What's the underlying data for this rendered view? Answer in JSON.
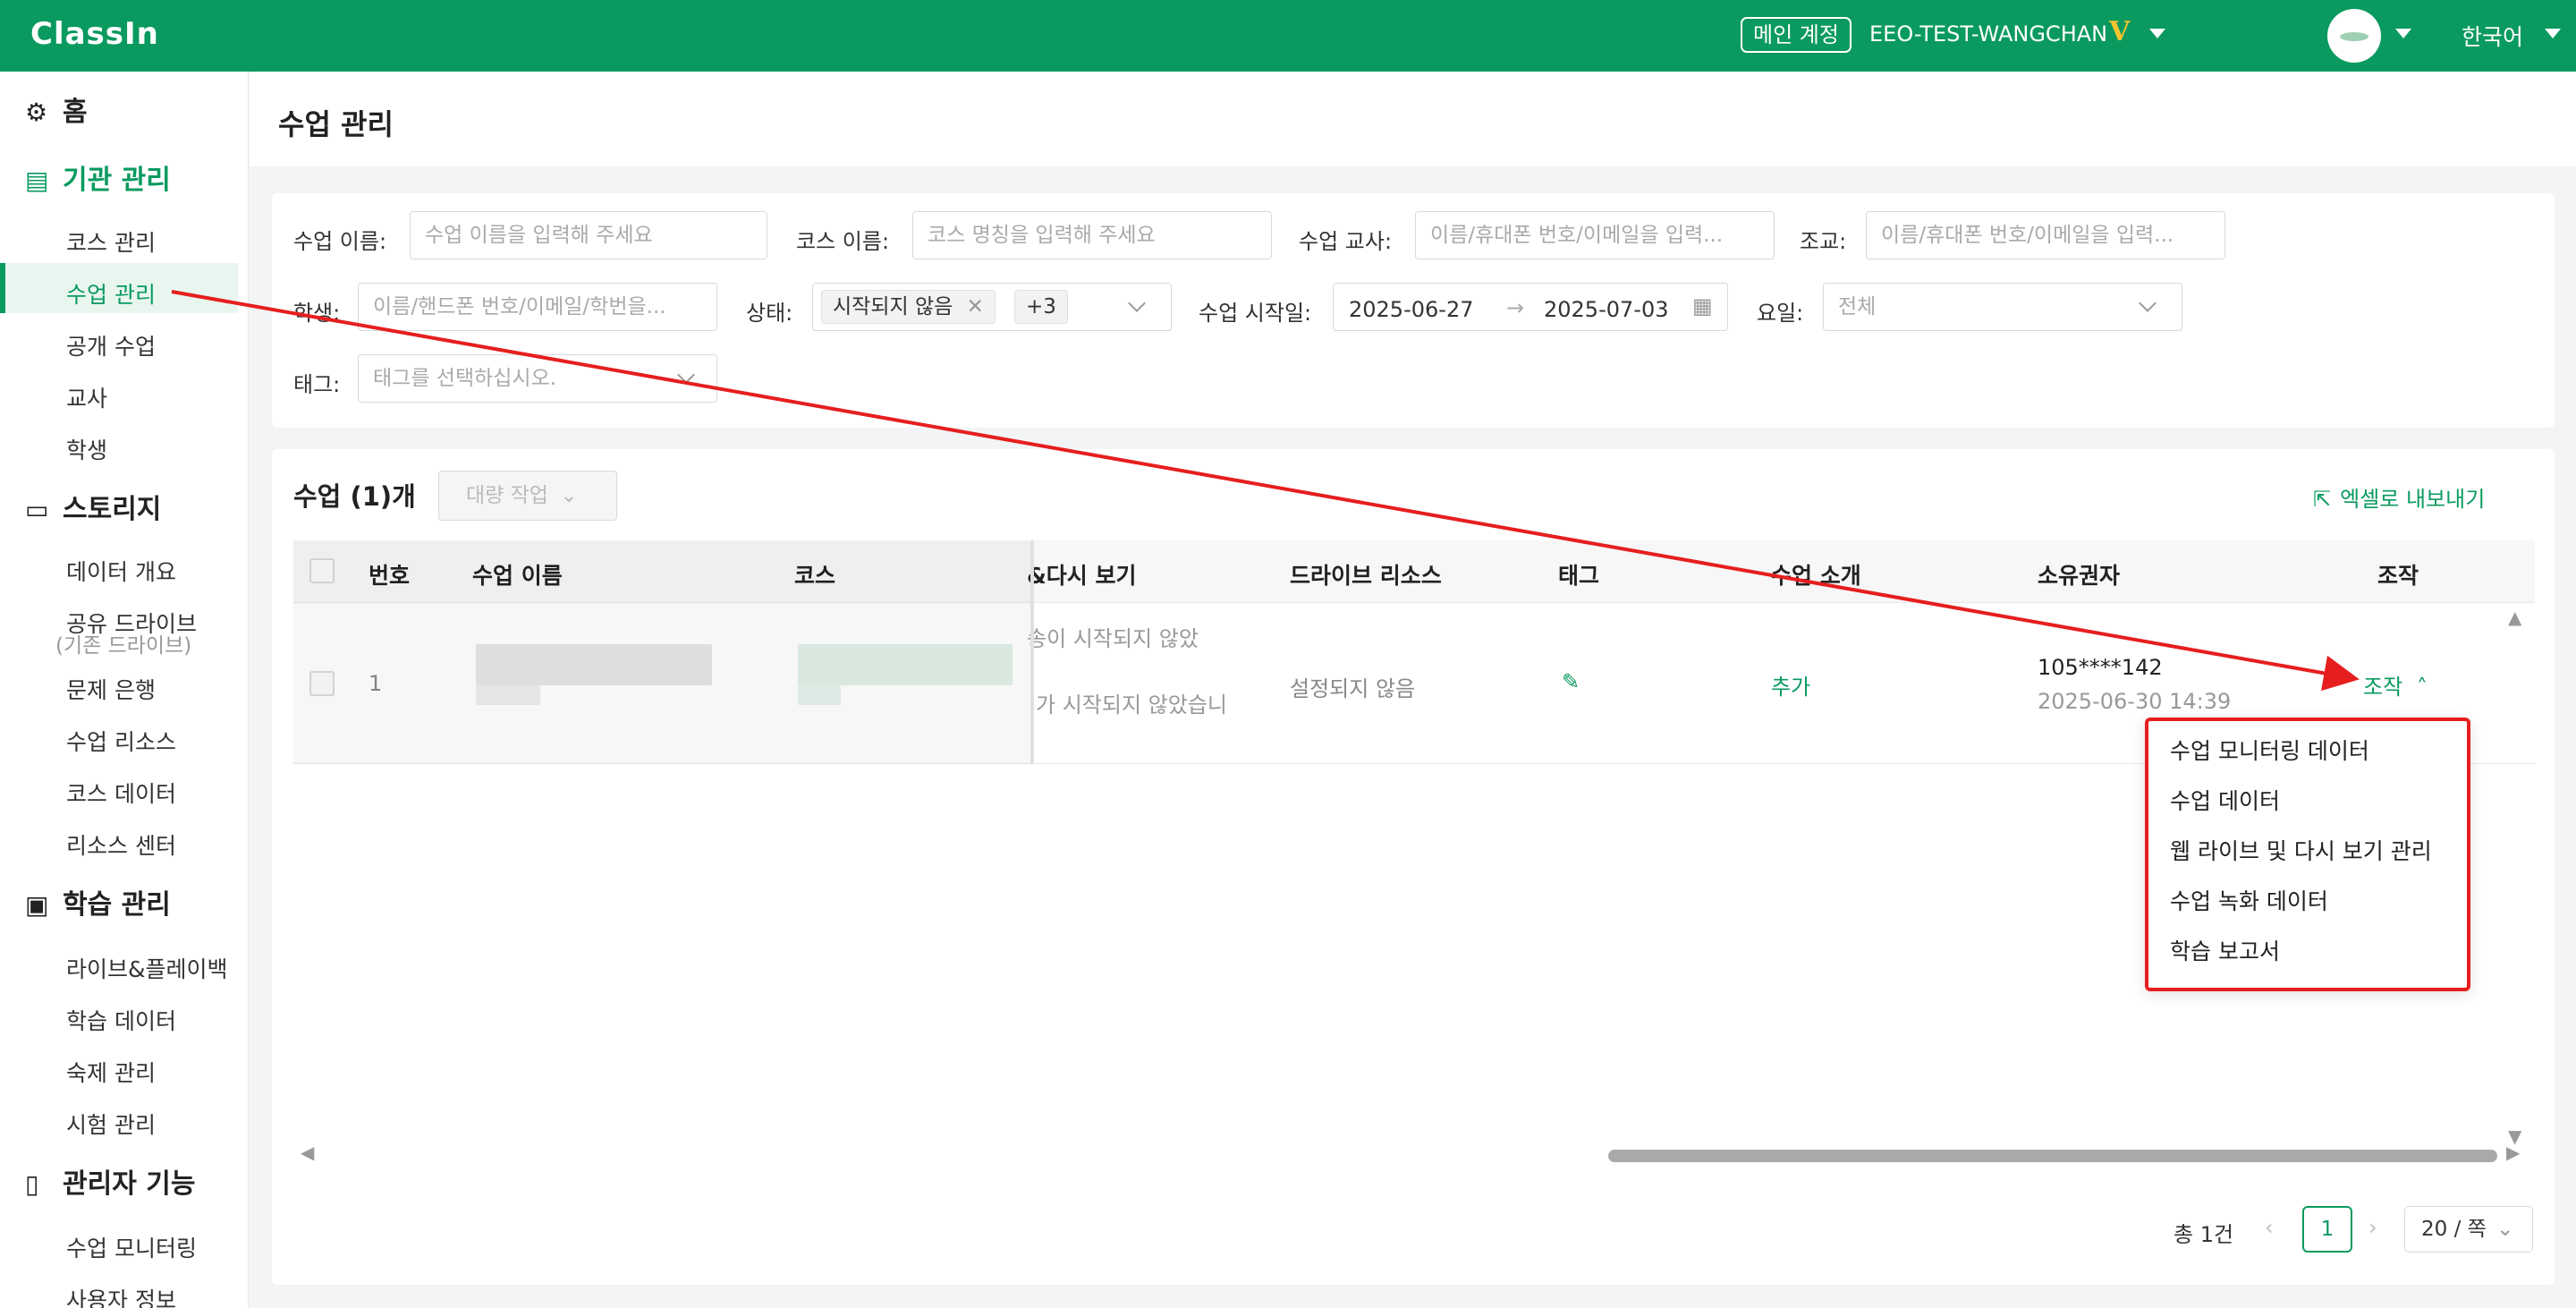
{
  "topbar": {
    "logo": "ClassIn",
    "account_badge": "메인 계정",
    "account_name": "EEO-TEST-WANGCHAN",
    "vip_mark": "V",
    "language": "한국어",
    "brand_color": "#0a9a5f"
  },
  "sidebar": {
    "home": "홈",
    "org": "기관 관리",
    "org_items": [
      "코스 관리",
      "수업 관리",
      "공개 수업",
      "교사",
      "학생"
    ],
    "storage": "스토리지",
    "storage_items": [
      "데이터 개요",
      "공유 드라이브",
      "(기존 드라이브)",
      "문제 은행",
      "수업 리소스",
      "코스 데이터",
      "리소스 센터"
    ],
    "learning": "학습 관리",
    "learning_items": [
      "라이브&플레이백",
      "학습 데이터",
      "숙제 관리",
      "시험 관리"
    ],
    "admin": "관리자 기능",
    "admin_items": [
      "수업 모니터링",
      "사용자 정보"
    ]
  },
  "page": {
    "title": "수업 관리"
  },
  "filters": {
    "lesson_name_label": "수업 이름:",
    "lesson_name_placeholder": "수업 이름을 입력해 주세요",
    "course_name_label": "코스 이름:",
    "course_name_placeholder": "코스 명칭을 입력해 주세요",
    "teacher_label": "수업 교사:",
    "teacher_placeholder": "이름/휴대폰 번호/이메일을 입력...",
    "assistant_label": "조교:",
    "assistant_placeholder": "이름/휴대폰 번호/이메일을 입력...",
    "student_label": "학생:",
    "student_placeholder": "이름/핸드폰 번호/이메일/학번을...",
    "status_label": "상태:",
    "status_chip": "시작되지 않음",
    "status_more": "+3",
    "start_label": "수업 시작일:",
    "start_from": "2025-06-27",
    "start_sep": "→",
    "start_to": "2025-07-03",
    "weekday_label": "요일:",
    "weekday_value": "전체",
    "tag_label": "태그:",
    "tag_placeholder": "태그를 선택하십시오."
  },
  "list": {
    "title": "수업 (1)개",
    "bulk_button": "대량 작업",
    "export_link": "엑셀로 내보내기",
    "columns": [
      "번호",
      "수업 이름",
      "코스",
      "&다시 보기",
      "드라이브 리소스",
      "태그",
      "수업 소개",
      "소유권자",
      "조작"
    ],
    "row": {
      "index": "1",
      "replay_line1": "송이 시작되지 않았",
      "replay_line2": "가 시작되지 않았습니",
      "drive": "설정되지 않음",
      "intro": "추가",
      "owner": "105****142",
      "owner_time": "2025-06-30 14:39",
      "action": "조작"
    }
  },
  "pagination": {
    "total": "총 1건",
    "current": "1",
    "page_size": "20 / 쪽"
  },
  "action_menu": {
    "items": [
      "수업 모니터링 데이터",
      "수업 데이터",
      "웹 라이브 및 다시 보기 관리",
      "수업 녹화 데이터",
      "학습 보고서"
    ],
    "highlight_color": "#e61e1e"
  }
}
